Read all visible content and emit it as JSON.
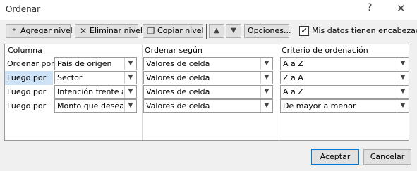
{
  "dialog": {
    "title": "Ordenar",
    "help": "?",
    "close": "✕"
  },
  "toolbar": {
    "add_level": "Agregar nivel",
    "delete_level": "Eliminar nivel",
    "copy_level": "Copiar nivel",
    "move_up": "▲",
    "move_down": "▼",
    "options": "Opciones...",
    "headers_checkbox_label": "Mis datos tienen encabezados",
    "headers_checked": true
  },
  "columns": {
    "column": "Columna",
    "sort_on": "Ordenar según",
    "order": "Criterio de ordenación"
  },
  "rows": [
    {
      "label": "Ordenar por",
      "column": "País de origen",
      "sort_on": "Valores de celda",
      "order": "A a Z"
    },
    {
      "label": "Luego por",
      "column": "Sector",
      "sort_on": "Valores de celda",
      "order": "Z a A"
    },
    {
      "label": "Luego por",
      "column": "Intención frente a lo",
      "sort_on": "Valores de celda",
      "order": "A a Z"
    },
    {
      "label": "Luego por",
      "column": "Monto que desea inv",
      "sort_on": "Valores de celda",
      "order": "De mayor a menor"
    }
  ],
  "footer": {
    "accept": "Aceptar",
    "cancel": "Cancelar"
  }
}
